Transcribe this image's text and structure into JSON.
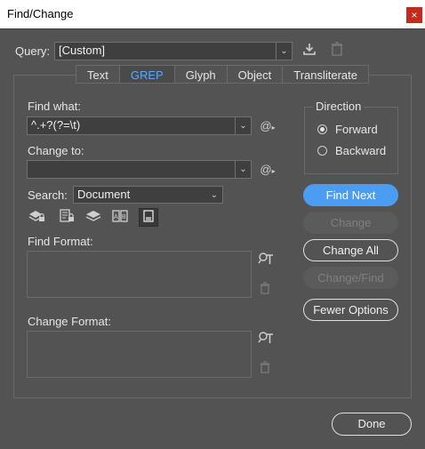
{
  "window": {
    "title": "Find/Change",
    "close_glyph": "×"
  },
  "query": {
    "label": "Query:",
    "value": "[Custom]",
    "save_icon": "save-query-icon",
    "delete_icon": "trash-icon"
  },
  "tabs": [
    {
      "label": "Text",
      "active": false
    },
    {
      "label": "GREP",
      "active": true
    },
    {
      "label": "Glyph",
      "active": false
    },
    {
      "label": "Object",
      "active": false
    },
    {
      "label": "Transliterate",
      "active": false
    }
  ],
  "find_what": {
    "label": "Find what:",
    "value": "^.+?(?=\\t)"
  },
  "change_to": {
    "label": "Change to:",
    "value": ""
  },
  "search": {
    "label": "Search:",
    "value": "Document"
  },
  "find_format": {
    "label": "Find Format:"
  },
  "change_format": {
    "label": "Change Format:"
  },
  "direction": {
    "label": "Direction",
    "options": [
      "Forward",
      "Backward"
    ],
    "selected": "Forward"
  },
  "buttons": {
    "find_next": "Find Next",
    "change": "Change",
    "change_all": "Change All",
    "change_find": "Change/Find",
    "fewer_options": "Fewer Options",
    "done": "Done"
  },
  "colors": {
    "accent": "#4a9df0",
    "bg": "#535353",
    "close": "#c42b1c"
  }
}
